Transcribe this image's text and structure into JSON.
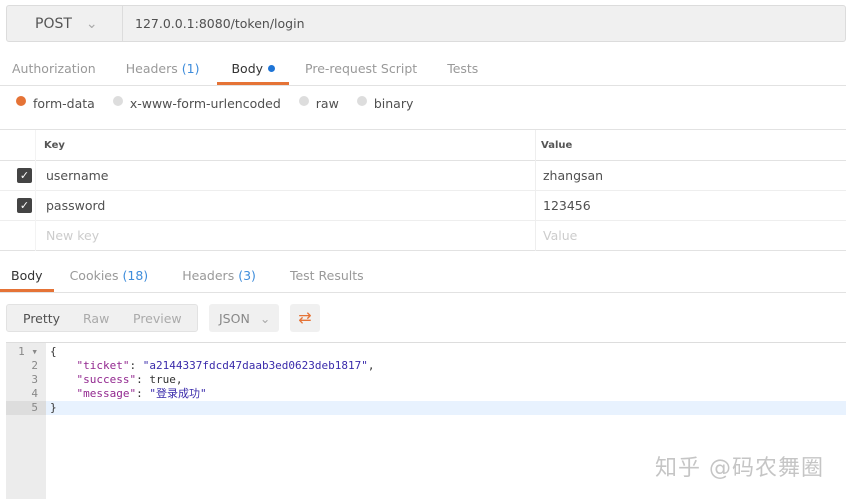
{
  "request": {
    "method": "POST",
    "url": "127.0.0.1:8080/token/login"
  },
  "request_tabs": [
    {
      "label": "Authorization"
    },
    {
      "label": "Headers",
      "count": "(1)"
    },
    {
      "label": "Body"
    },
    {
      "label": "Pre-request Script"
    },
    {
      "label": "Tests"
    }
  ],
  "body_modes": [
    {
      "label": "form-data",
      "selected": true
    },
    {
      "label": "x-www-form-urlencoded"
    },
    {
      "label": "raw"
    },
    {
      "label": "binary"
    }
  ],
  "params": {
    "key_header": "Key",
    "value_header": "Value",
    "rows": [
      {
        "key": "username",
        "value": "zhangsan",
        "checked": true
      },
      {
        "key": "password",
        "value": "123456",
        "checked": true
      }
    ],
    "new_key_placeholder": "New key",
    "new_value_placeholder": "Value"
  },
  "response_tabs": [
    {
      "label": "Body"
    },
    {
      "label": "Cookies",
      "count": "(18)"
    },
    {
      "label": "Headers",
      "count": "(3)"
    },
    {
      "label": "Test Results"
    }
  ],
  "view_modes": [
    "Pretty",
    "Raw",
    "Preview"
  ],
  "format": "JSON",
  "response": {
    "lines": [
      "{",
      "\"ticket\"",
      "\"a2144337fdcd47daab3ed0623deb1817\"",
      "\"success\"",
      "true",
      "\"message\"",
      "\"登录成功\"",
      "}"
    ]
  },
  "watermark": "知乎 @码农舞圈",
  "colors": {
    "accent": "#e57336",
    "count": "#3f8ddb",
    "json_key": "#92278f",
    "json_string": "#3a2bab"
  }
}
